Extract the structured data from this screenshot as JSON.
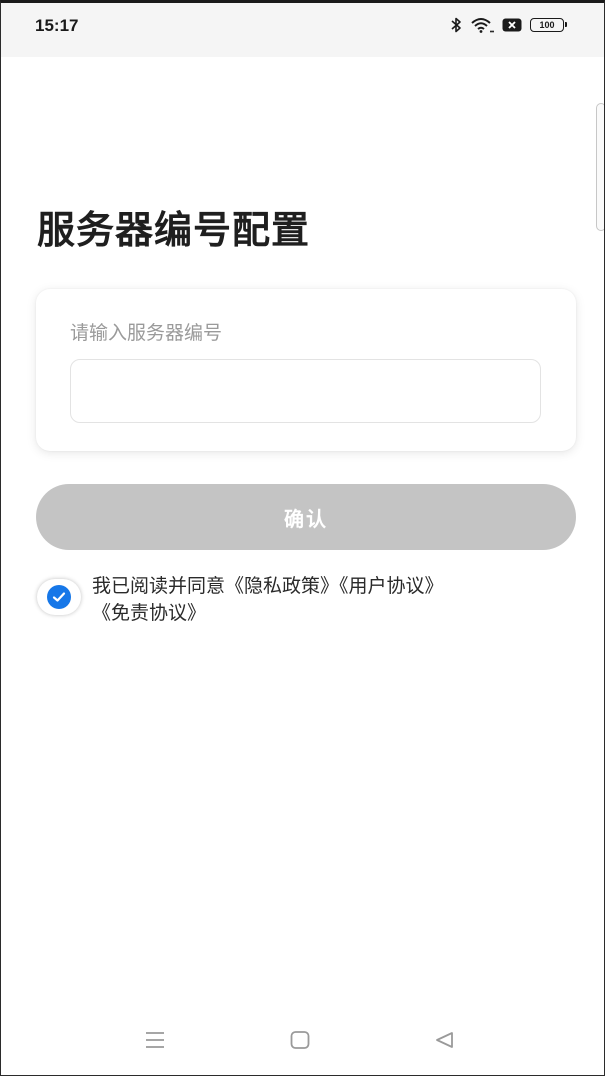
{
  "status_bar": {
    "time": "15:17",
    "battery_level": "100",
    "icons": [
      "bluetooth-icon",
      "wifi-icon",
      "sim-icon",
      "battery-icon"
    ]
  },
  "page": {
    "title": "服务器编号配置"
  },
  "form": {
    "label": "请输入服务器编号",
    "input_value": "",
    "input_placeholder": ""
  },
  "confirm_button": {
    "label": "确认",
    "color": "#c4c4c4"
  },
  "agreement": {
    "checked": true,
    "prefix": "我已阅读并同意",
    "privacy_policy": "《隐私政策》",
    "user_agreement": "《用户协议》",
    "disclaimer": "《免责协议》",
    "check_color": "#1677e8"
  },
  "nav_bar": {
    "buttons": [
      "menu-icon",
      "home-icon",
      "back-icon"
    ]
  }
}
